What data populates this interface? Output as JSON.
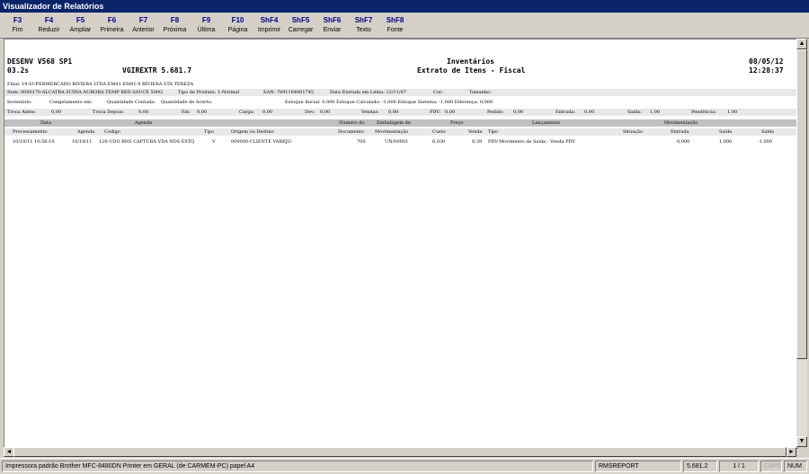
{
  "window": {
    "title": "Visualizador de Relatórios"
  },
  "toolbar": [
    {
      "key": "F3",
      "label": "Fim"
    },
    {
      "key": "F4",
      "label": "Reduzir"
    },
    {
      "key": "F5",
      "label": "Ampliar"
    },
    {
      "key": "F6",
      "label": "Primeira"
    },
    {
      "key": "F7",
      "label": "Anterior"
    },
    {
      "key": "F8",
      "label": "Próxima"
    },
    {
      "key": "F9",
      "label": "Última"
    },
    {
      "key": "F10",
      "label": "Página"
    },
    {
      "key": "ShF4",
      "label": "Imprimir"
    },
    {
      "key": "ShF5",
      "label": "Carregar"
    },
    {
      "key": "ShF6",
      "label": "Enviar"
    },
    {
      "key": "ShF7",
      "label": "Texto"
    },
    {
      "key": "ShF8",
      "label": "Fonte"
    }
  ],
  "report": {
    "env": "DESENV V568 SP1",
    "version_left": "03.2s",
    "program": "VGIREXTR 5.681.7",
    "title": "Inventários",
    "subtitle": "Extrato de Itens - Fiscal",
    "date": "08/05/12",
    "time": "12:28:37",
    "filial": "Filial:  19-SUPERMERCADO RIVIERA LTDA EM41    EM41-9 RIVIERA STA TEREZA",
    "item_line": {
      "item": "Item:  0000170-ALCATRA SUINA AURORA TEMP RED SAUCE 500G",
      "tipo": "Tipo de Produto: 1-Normal",
      "ean": "EAN: 7891164001745",
      "data": "Data Entrada em Linha: 12/11/07",
      "cor": "Cor:",
      "tamanho": "Tamanho:"
    },
    "inv_line": {
      "inventario": "Inventário:",
      "congelamento": "Congelamento em:",
      "qtd_contada": "Quantidade Contada:",
      "qtd_acerto": "Quantidade de Acerto:",
      "estoques": "Estoque Inicial: 0,000 Estoque Calculado: -1,000 Estoque Sistema: -1,000 Diferença: 0,000"
    },
    "totals": [
      {
        "label": "Troca Antes:",
        "value": "0,00"
      },
      {
        "label": "Troca Depois:",
        "value": "0,00"
      },
      {
        "label": "Fat:",
        "value": "0,00"
      },
      {
        "label": "Carga:",
        "value": "0,00"
      },
      {
        "label": "Dev:",
        "value": "0,00"
      },
      {
        "label": "Vendas:",
        "value": "0,00"
      },
      {
        "label": "PDV:",
        "value": "0,00"
      },
      {
        "label": "Pedido:",
        "value": "0,00"
      },
      {
        "label": "Entrada:",
        "value": "0,00"
      },
      {
        "label": "Saída:",
        "value": "1,00"
      },
      {
        "label": "Pendência:",
        "value": "1,00"
      }
    ],
    "header_row1": [
      "Data",
      "Agenda",
      "Numero do",
      "Embalagem de",
      "Preço",
      "Lançamento",
      "Movimentação"
    ],
    "header_row2": [
      "Processamento",
      "Agenda",
      "Codigo",
      "Tipo",
      "Origem ou Destino",
      "Documento",
      "Movimentação",
      "Custo",
      "Venda",
      "Tipo",
      "Situação",
      "Entrada",
      "Saída",
      "Saldo"
    ],
    "rows": [
      [
        "10/10/11 10:56:10",
        "10/10/11",
        "120-UDO BNS CAPTURA VDA NDS ESTQ",
        "V",
        "000000-CLIENTE VAREJO",
        "700",
        "UN/00001",
        "6,030",
        "8,39",
        "PDV-Movimento de Saida - Venda PDV",
        "",
        "0,000",
        "1,000",
        "-1,000"
      ]
    ]
  },
  "status": {
    "printer": "Impressora padrão Brother MFC-8480DN Printer em GERAL (de CARMEM-PC) papel A4",
    "app": "RMSREPORT",
    "version": "5.681.2",
    "page": "1 / 1",
    "caps": "CAPS",
    "num": "NUM"
  }
}
